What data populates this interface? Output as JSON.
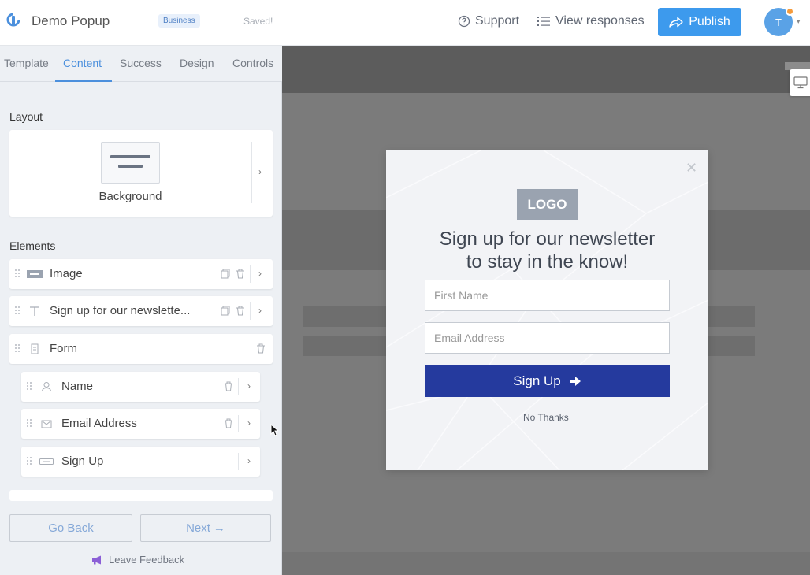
{
  "header": {
    "title": "Demo Popup",
    "plan_badge": "Business",
    "save_status": "Saved!",
    "support": "Support",
    "view_responses": "View responses",
    "publish": "Publish",
    "avatar_initial": "T"
  },
  "tabs": [
    "Template",
    "Content",
    "Success",
    "Design",
    "Controls"
  ],
  "active_tab": "Content",
  "sidebar": {
    "layout_title": "Layout",
    "layout_option": "Background",
    "elements_title": "Elements",
    "elements": [
      {
        "label": "Image",
        "icon": "logo-thumbnail-icon"
      },
      {
        "label": "Sign up for our newslette...",
        "icon": "text-icon"
      },
      {
        "label": "Form",
        "icon": "form-icon"
      },
      {
        "label": "Name",
        "icon": "person-icon"
      },
      {
        "label": "Email Address",
        "icon": "envelope-icon"
      },
      {
        "label": "Sign Up",
        "icon": "button-icon"
      }
    ],
    "go_back": "Go Back",
    "next": "Next",
    "leave_feedback": "Leave Feedback"
  },
  "popup": {
    "logo": "LOGO",
    "heading_line1": "Sign up for our newsletter",
    "heading_line2": "to stay in the know!",
    "first_name_placeholder": "First Name",
    "email_placeholder": "Email Address",
    "submit": "Sign Up",
    "decline": "No Thanks"
  },
  "colors": {
    "accent": "#4c90dd",
    "publish": "#3d9aed",
    "submit": "#253a9e",
    "notification": "#f59b3c"
  }
}
